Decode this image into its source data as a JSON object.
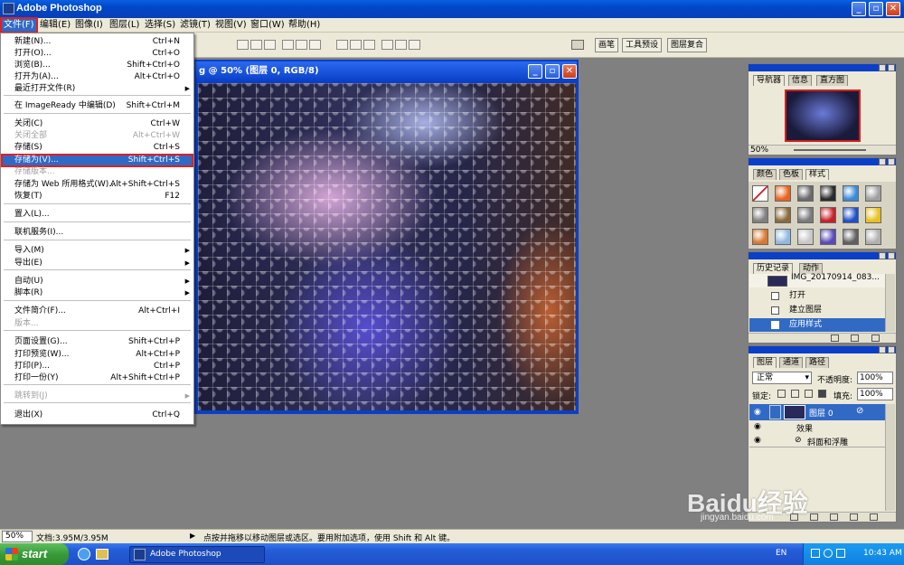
{
  "window": {
    "title": "Adobe Photoshop"
  },
  "menubar": [
    "文件(F)",
    "编辑(E)",
    "图像(I)",
    "图层(L)",
    "选择(S)",
    "滤镜(T)",
    "视图(V)",
    "窗口(W)",
    "帮助(H)"
  ],
  "palette_well": {
    "tabs": [
      "画笔",
      "工具预设",
      "图层复合"
    ]
  },
  "document": {
    "title": "g @ 50% (图层 0, RGB/8)"
  },
  "file_menu": {
    "items": [
      {
        "label": "新建(N)...",
        "shortcut": "Ctrl+N"
      },
      {
        "label": "打开(O)...",
        "shortcut": "Ctrl+O"
      },
      {
        "label": "浏览(B)...",
        "shortcut": "Shift+Ctrl+O"
      },
      {
        "label": "打开为(A)...",
        "shortcut": "Alt+Ctrl+O"
      },
      {
        "label": "最近打开文件(R)",
        "shortcut": "",
        "submenu": true
      },
      {
        "label": "在 ImageReady 中编辑(D)",
        "shortcut": "Shift+Ctrl+M"
      },
      {
        "label": "关闭(C)",
        "shortcut": "Ctrl+W"
      },
      {
        "label": "关闭全部",
        "shortcut": "Alt+Ctrl+W",
        "disabled": true
      },
      {
        "label": "存储(S)",
        "shortcut": "Ctrl+S"
      },
      {
        "label": "存储为(V)...",
        "shortcut": "Shift+Ctrl+S",
        "highlighted": true
      },
      {
        "label": "存储版本...",
        "shortcut": "",
        "disabled": true
      },
      {
        "label": "存储为 Web 所用格式(W)...",
        "shortcut": "Alt+Shift+Ctrl+S"
      },
      {
        "label": "恢复(T)",
        "shortcut": "F12"
      },
      {
        "label": "置入(L)...",
        "shortcut": ""
      },
      {
        "label": "联机服务(I)...",
        "shortcut": ""
      },
      {
        "label": "导入(M)",
        "shortcut": "",
        "submenu": true
      },
      {
        "label": "导出(E)",
        "shortcut": "",
        "submenu": true
      },
      {
        "label": "自动(U)",
        "shortcut": "",
        "submenu": true
      },
      {
        "label": "脚本(R)",
        "shortcut": "",
        "submenu": true
      },
      {
        "label": "文件简介(F)...",
        "shortcut": "Alt+Ctrl+I"
      },
      {
        "label": "版本...",
        "shortcut": "",
        "disabled": true
      },
      {
        "label": "页面设置(G)...",
        "shortcut": "Shift+Ctrl+P"
      },
      {
        "label": "打印预览(W)...",
        "shortcut": "Alt+Ctrl+P"
      },
      {
        "label": "打印(P)...",
        "shortcut": "Ctrl+P"
      },
      {
        "label": "打印一份(Y)",
        "shortcut": "Alt+Shift+Ctrl+P"
      },
      {
        "label": "跳转到(J)",
        "shortcut": "",
        "submenu": true,
        "disabled": true
      },
      {
        "label": "退出(X)",
        "shortcut": "Ctrl+Q"
      }
    ]
  },
  "navigator": {
    "tabs": [
      "导航器",
      "信息",
      "直方图"
    ],
    "zoom": "50%"
  },
  "swatches": {
    "tabs": [
      "颜色",
      "色板",
      "样式"
    ],
    "colors": [
      "#ffffff",
      "#e8641e",
      "#6a6a6a",
      "#2a2a2a",
      "#3a8ad8",
      "#a0a0a0",
      "#808080",
      "#8a6a3a",
      "#7a7a7a",
      "#c82028",
      "#1e50c8",
      "#e8c020",
      "#d87830",
      "#90b8e0",
      "#c8c8c8",
      "#5a4ab8",
      "#606060",
      "#b0b0b0"
    ]
  },
  "history": {
    "tabs": [
      "历史记录",
      "动作"
    ],
    "snapshot": "IMG_20170914_083...",
    "steps": [
      "打开",
      "建立图层",
      "应用样式"
    ]
  },
  "layers": {
    "tabs": [
      "图层",
      "通道",
      "路径"
    ],
    "blend": "正常",
    "opacity_label": "不透明度:",
    "opacity": "100%",
    "lock_label": "锁定:",
    "fill_label": "填充:",
    "fill": "100%",
    "layer_name": "图层 0",
    "effects_label": "效果",
    "effect": "斜面和浮雕"
  },
  "status": {
    "zoom": "50%",
    "doc": "文档:3.95M/3.95M",
    "hint": "点按并拖移以移动图层或选区。要用附加选项，使用 Shift 和 Alt 键。"
  },
  "taskbar": {
    "start": "start",
    "task": "Adobe Photoshop",
    "lang": "EN",
    "time": "10:43 AM"
  },
  "watermark": {
    "brand": "Baidu经验",
    "url": "jingyan.baidu.com"
  }
}
